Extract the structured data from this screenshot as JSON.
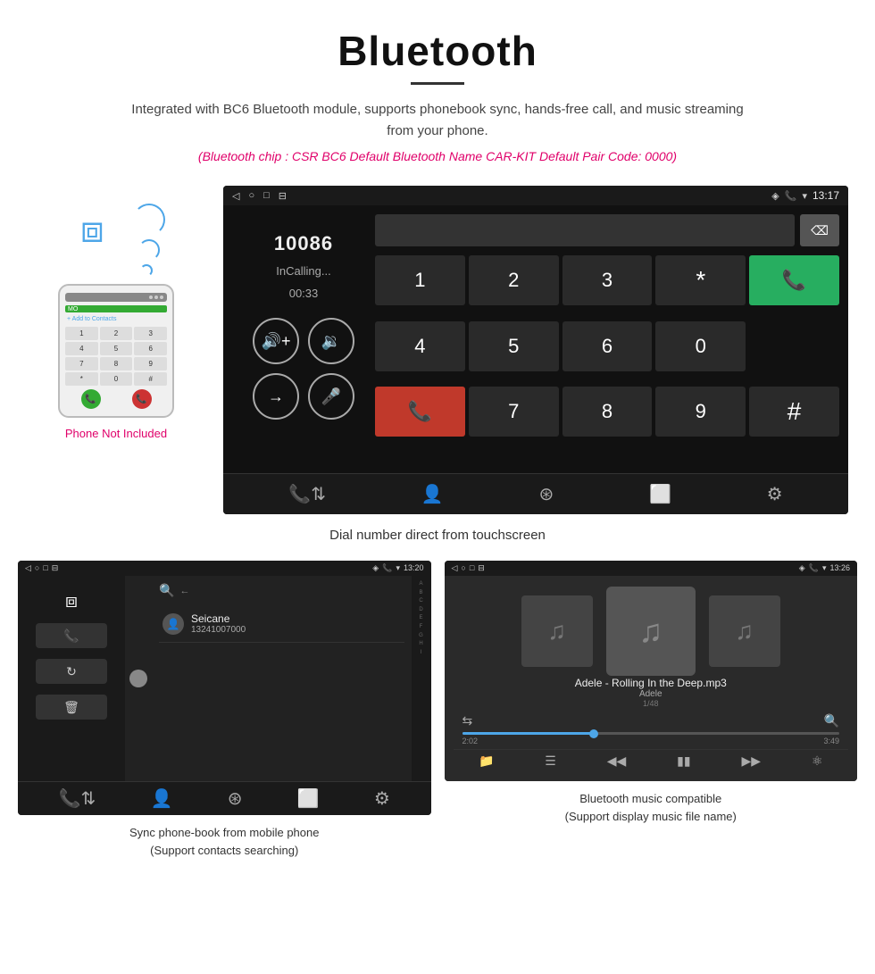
{
  "header": {
    "title": "Bluetooth",
    "description": "Integrated with BC6 Bluetooth module, supports phonebook sync, hands-free call, and music streaming from your phone.",
    "specs": "(Bluetooth chip : CSR BC6    Default Bluetooth Name CAR-KIT    Default Pair Code: 0000)"
  },
  "phone_mockup": {
    "not_included": "Phone Not Included",
    "add_contact": "+ Add to Contacts"
  },
  "car_screen": {
    "status": {
      "time": "13:17"
    },
    "call": {
      "number": "10086",
      "status": "InCalling...",
      "timer": "00:33"
    },
    "dialpad": {
      "keys": [
        "1",
        "2",
        "3",
        "*",
        "4",
        "5",
        "6",
        "0",
        "7",
        "8",
        "9",
        "#"
      ]
    }
  },
  "caption_main": "Dial number direct from touchscreen",
  "bottom_left": {
    "screen_time": "13:20",
    "contact_name": "Seicane",
    "contact_number": "13241007000",
    "caption_line1": "Sync phone-book from mobile phone",
    "caption_line2": "(Support contacts searching)"
  },
  "bottom_right": {
    "screen_time": "13:26",
    "song_name": "Adele - Rolling In the Deep.mp3",
    "artist": "Adele",
    "track_count": "1/48",
    "time_current": "2:02",
    "time_total": "3:49",
    "caption_line1": "Bluetooth music compatible",
    "caption_line2": "(Support display music file name)"
  }
}
